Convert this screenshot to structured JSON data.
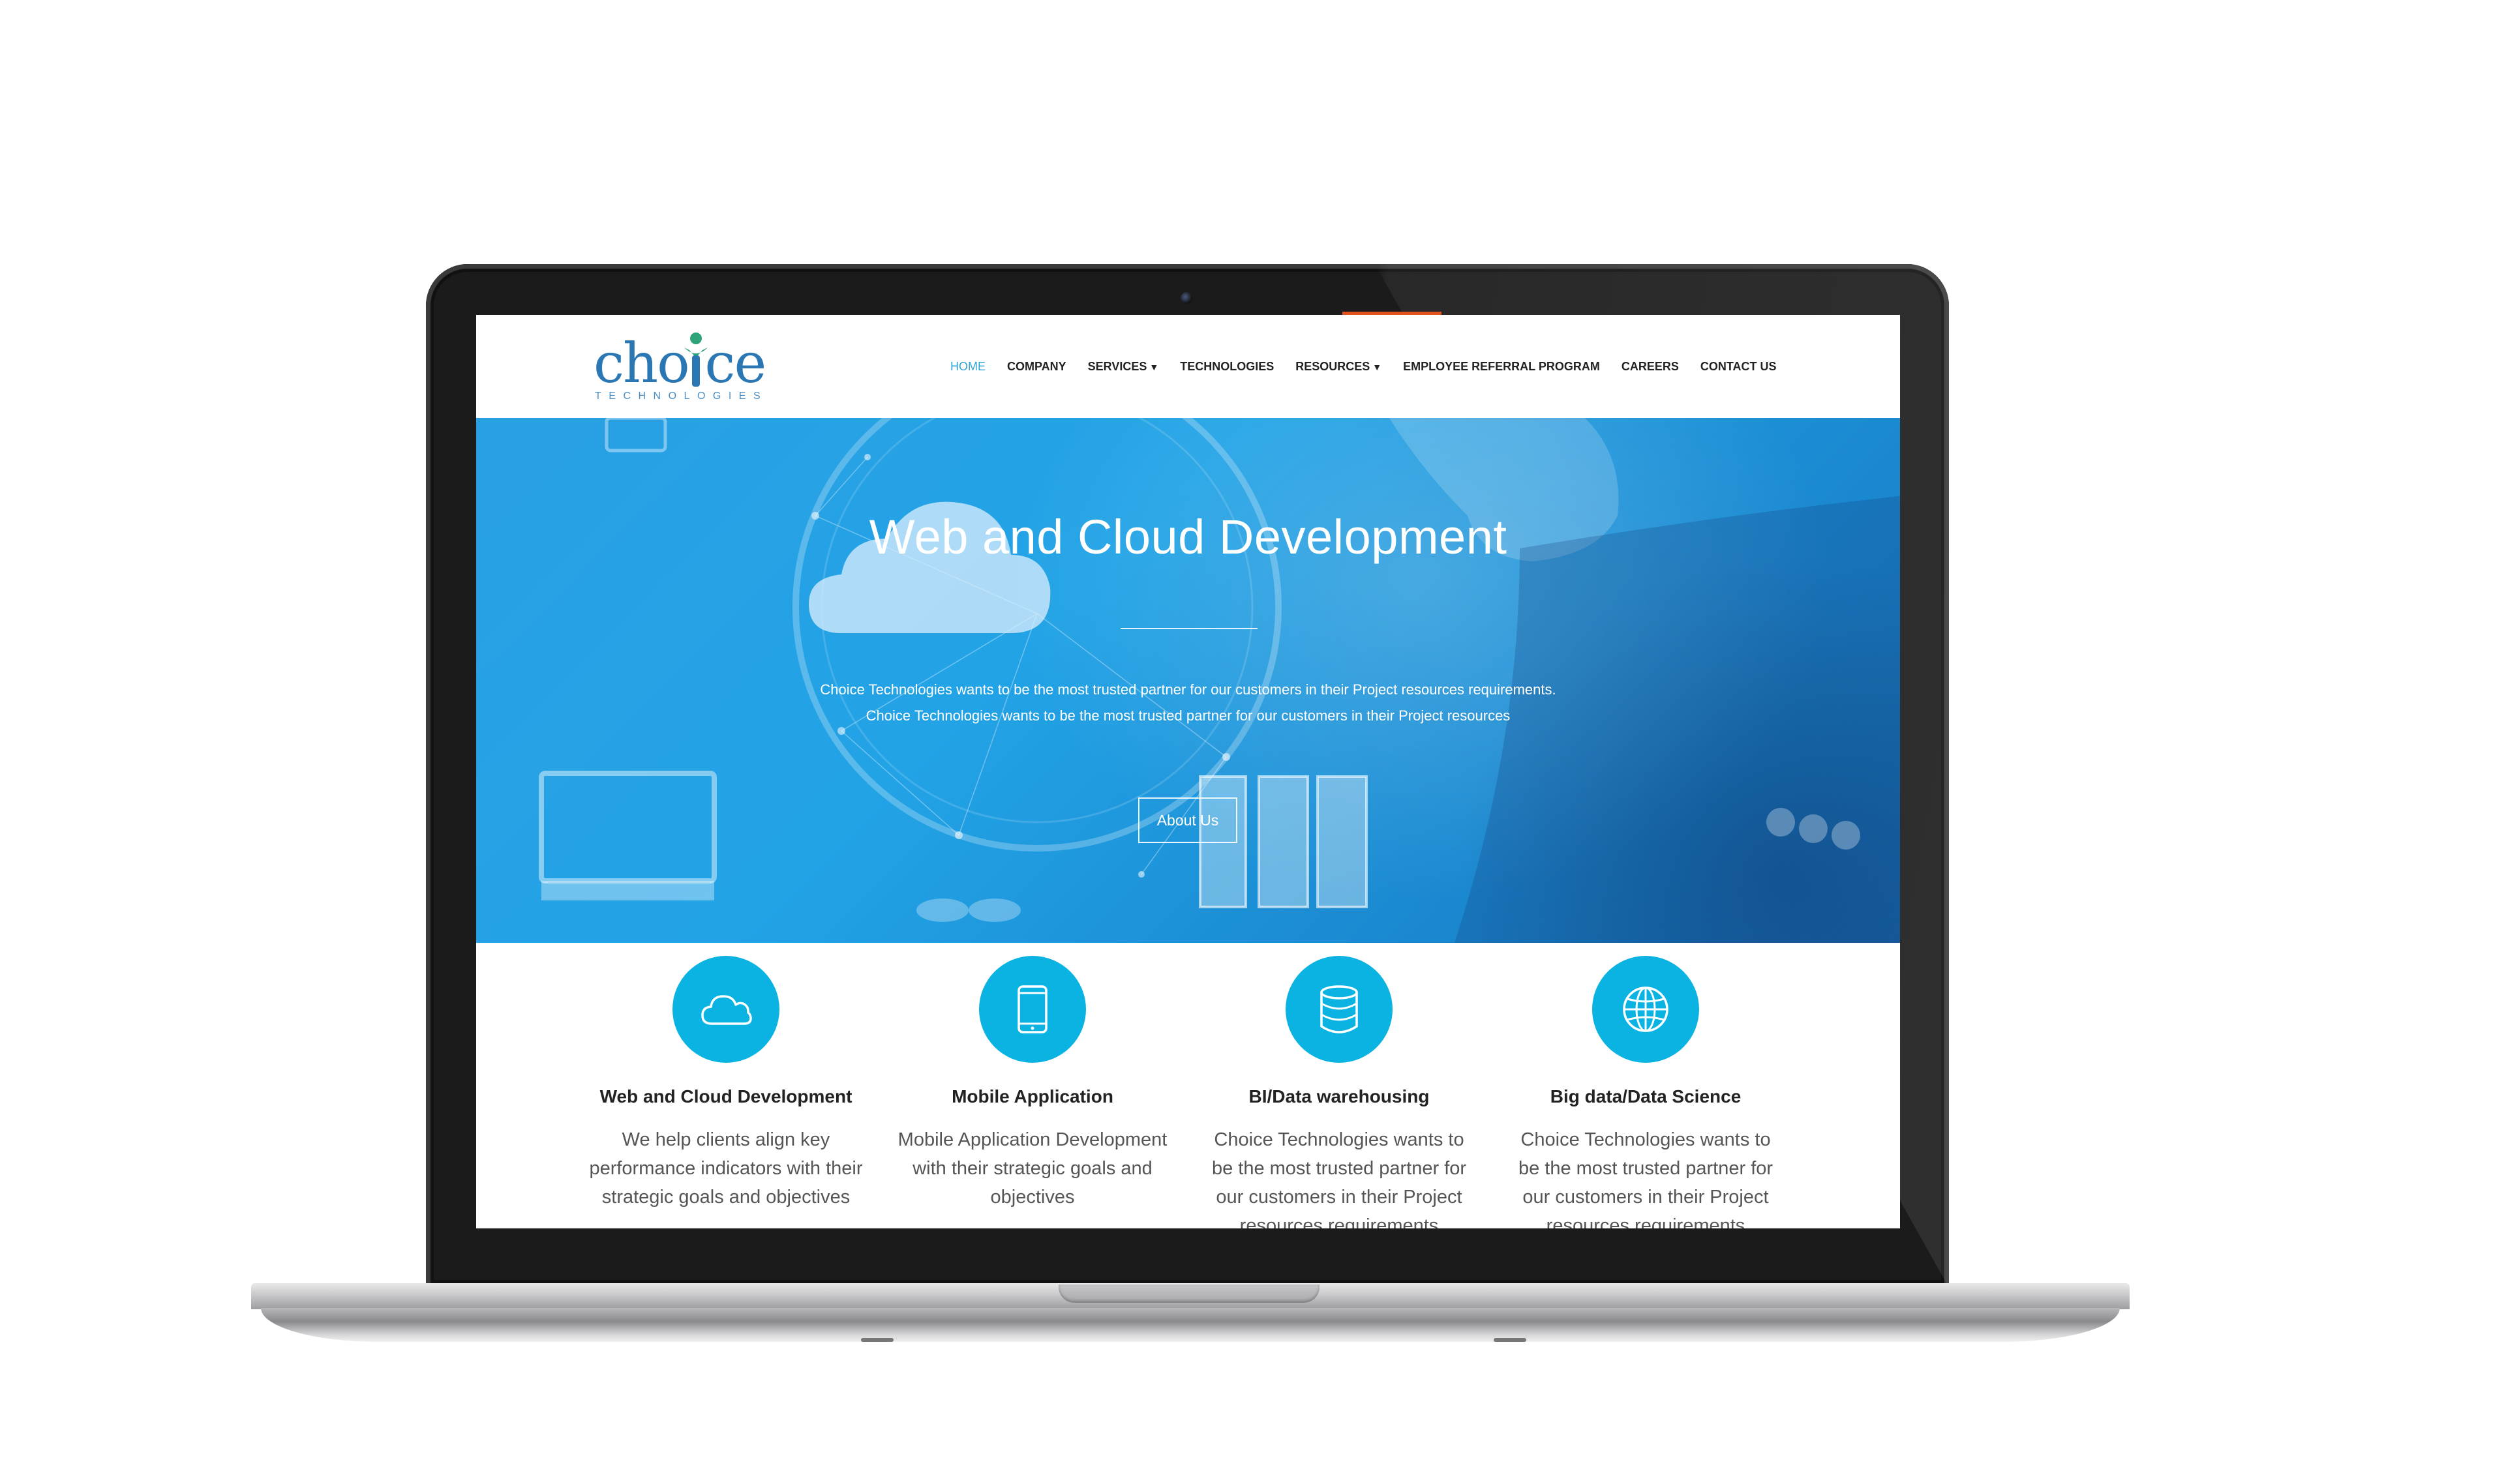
{
  "brand": {
    "logo_word": "cho ce",
    "logo_sub": "TECHNOLOGIES"
  },
  "nav": {
    "items": [
      {
        "label": "HOME",
        "active": true
      },
      {
        "label": "COMPANY"
      },
      {
        "label": "SERVICES",
        "dropdown": true
      },
      {
        "label": "TECHNOLOGIES"
      },
      {
        "label": "RESOURCES",
        "dropdown": true
      },
      {
        "label": "EMPLOYEE REFERRAL PROGRAM"
      },
      {
        "label": "CAREERS"
      },
      {
        "label": "CONTACT US"
      }
    ],
    "caret": "▼"
  },
  "hero": {
    "title": "Web and Cloud Development",
    "line1": "Choice Technologies wants to be the most trusted partner for our customers in their Project resources requirements.",
    "line2": "Choice Technologies wants to be the most trusted partner for our customers in their Project resources",
    "button": "About Us"
  },
  "services": [
    {
      "icon": "cloud-icon",
      "title": "Web and Cloud Development",
      "desc": "We help clients align key performance indicators with their strategic goals and objectives"
    },
    {
      "icon": "mobile-icon",
      "title": "Mobile Application",
      "desc": "Mobile Application Development with their strategic goals and objectives"
    },
    {
      "icon": "database-icon",
      "title": "BI/Data warehousing",
      "desc": "Choice Technologies wants to be the most trusted partner for our customers in their Project resources requirements"
    },
    {
      "icon": "globe-icon",
      "title": "Big data/Data Science",
      "desc": "Choice Technologies wants to be the most trusted partner for our customers in their Project resources requirements"
    }
  ],
  "colors": {
    "accent": "#0ab3e2",
    "nav_active": "#2fa3d6",
    "hero_blue": "#22a3e6",
    "highlight": "#e0531f"
  }
}
